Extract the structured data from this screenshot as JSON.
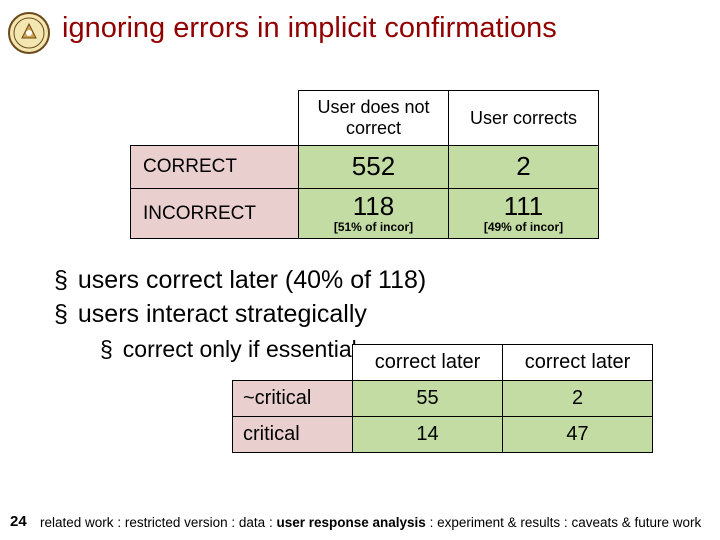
{
  "title": "ignoring errors in implicit confirmations",
  "table1": {
    "cols": [
      "User does not correct",
      "User corrects"
    ],
    "rows": [
      {
        "label": "CORRECT",
        "cells": [
          {
            "value": "552"
          },
          {
            "value": "2"
          }
        ]
      },
      {
        "label": "INCORRECT",
        "cells": [
          {
            "value": "118",
            "sub": "[51% of incor]"
          },
          {
            "value": "111",
            "sub": "[49% of incor]"
          }
        ]
      }
    ]
  },
  "bullets": [
    "users correct later (40% of 118)",
    "users interact strategically",
    "correct only if essential"
  ],
  "table2": {
    "cols": [
      "correct later",
      "correct later"
    ],
    "rows": [
      {
        "label": "~critical",
        "cells": [
          "55",
          "2"
        ]
      },
      {
        "label": "critical",
        "cells": [
          "14",
          "47"
        ]
      }
    ]
  },
  "page": "24",
  "footer": {
    "0": "related work",
    "1": "restricted version",
    "2": "data",
    "3": "user response analysis",
    "4": "experiment & results",
    "5": "caveats & future work",
    "sep": " : "
  },
  "chart_data": [
    {
      "type": "table",
      "title": "ignoring errors in implicit confirmations",
      "columns": [
        "",
        "User does not correct",
        "User corrects"
      ],
      "rows": [
        [
          "CORRECT",
          552,
          2
        ],
        [
          "INCORRECT",
          118,
          111
        ]
      ],
      "annotations": {
        "INCORRECT": [
          "51% of incor",
          "49% of incor"
        ]
      }
    },
    {
      "type": "table",
      "columns": [
        "",
        "correct later",
        "correct later"
      ],
      "rows": [
        [
          "~critical",
          55,
          2
        ],
        [
          "critical",
          14,
          47
        ]
      ]
    }
  ]
}
